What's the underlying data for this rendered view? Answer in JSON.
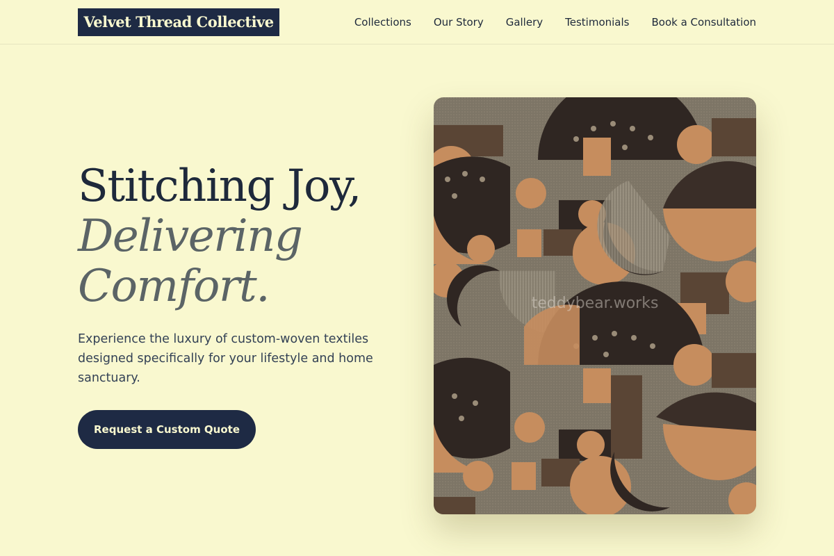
{
  "header": {
    "logo": "Velvet Thread Collective",
    "nav": [
      "Collections",
      "Our Story",
      "Gallery",
      "Testimonials",
      "Book a Consultation"
    ]
  },
  "hero": {
    "title_line1": "Stitching Joy,",
    "title_line2": "Delivering",
    "title_line3": "Comfort.",
    "subtitle": "Experience the luxury of custom-woven textiles designed specifically for your lifestyle and home sanctuary.",
    "cta_label": "Request a Custom Quote",
    "image_watermark": "teddybear.works"
  },
  "colors": {
    "background": "#f9f8cf",
    "navy": "#1e2a44",
    "muted_text": "#5b6466",
    "fabric_base": "#7d7566",
    "fabric_tan": "#c68d5e",
    "fabric_dark": "#2f2622"
  }
}
